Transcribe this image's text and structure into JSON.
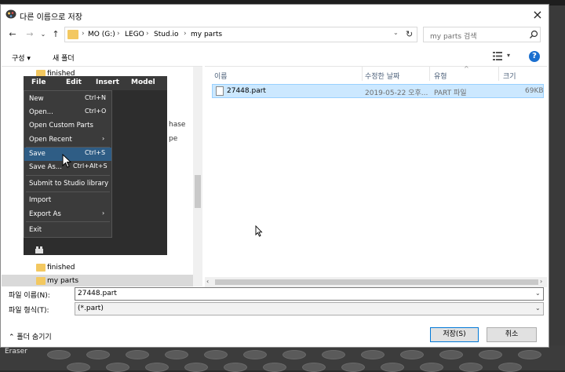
{
  "dialog": {
    "title": "다른 이름으로 저장",
    "close_icon": "×"
  },
  "nav": {
    "back_icon": "←",
    "forward_icon": "→",
    "dropdown_icon": "⌄",
    "up_icon": "↑",
    "breadcrumbs": [
      "MO (G:)",
      "LEGO",
      "Stud.io",
      "my parts"
    ],
    "crumb_separator": "›",
    "refresh_icon": "↻",
    "search_placeholder": "my parts 검색"
  },
  "toolbar": {
    "organize_label": "구성 ▾",
    "new_folder_label": "새 폴더",
    "view_dropdown": "▾",
    "help_label": "?"
  },
  "nav_pane": {
    "folders": [
      {
        "label": "finished",
        "selected": false
      },
      {
        "label": "finished",
        "selected": false
      },
      {
        "label": "my parts",
        "selected": true
      }
    ]
  },
  "files_pane": {
    "columns": [
      "이름",
      "수정한 날짜",
      "유형",
      "크기"
    ],
    "sort_indicator": "^",
    "rows": [
      {
        "name": "27448.part",
        "modified": "2019-05-22 오후...",
        "type": "PART 파일",
        "size": "69KB"
      }
    ],
    "scroll_left": "‹",
    "scroll_right": "›"
  },
  "form": {
    "filename_label": "파일 이름(N):",
    "filename_value": "27448.part",
    "filetype_label": "파일 형식(T):",
    "filetype_value": "(*.part)",
    "dropdown_icon": "⌄"
  },
  "footer": {
    "hide_folders_label": "⌃  폴더 숨기기",
    "save_label": "저장(S)",
    "cancel_label": "취소"
  },
  "studio_menu": {
    "menubar": [
      "File",
      "Edit",
      "Insert",
      "Model"
    ],
    "items": [
      {
        "label": "New",
        "shortcut": "Ctrl+N"
      },
      {
        "label": "Open...",
        "shortcut": "Ctrl+O"
      },
      {
        "label": "Open Custom Parts",
        "shortcut": ""
      },
      {
        "label": "Open Recent",
        "shortcut": "",
        "submenu_arrow": "›"
      },
      {
        "label": "Save",
        "shortcut": "Ctrl+S",
        "highlighted": true
      },
      {
        "label": "Save As...",
        "shortcut": "Ctrl+Alt+S"
      },
      {
        "label": "Submit to Studio library",
        "shortcut": ""
      },
      {
        "label": "Import",
        "shortcut": ""
      },
      {
        "label": "Export As",
        "shortcut": "",
        "submenu_arrow": "›"
      },
      {
        "label": "Exit",
        "shortcut": ""
      }
    ],
    "ghost_text": [
      "hase",
      "pe"
    ]
  },
  "background": {
    "eraser_label": "Eraser"
  }
}
